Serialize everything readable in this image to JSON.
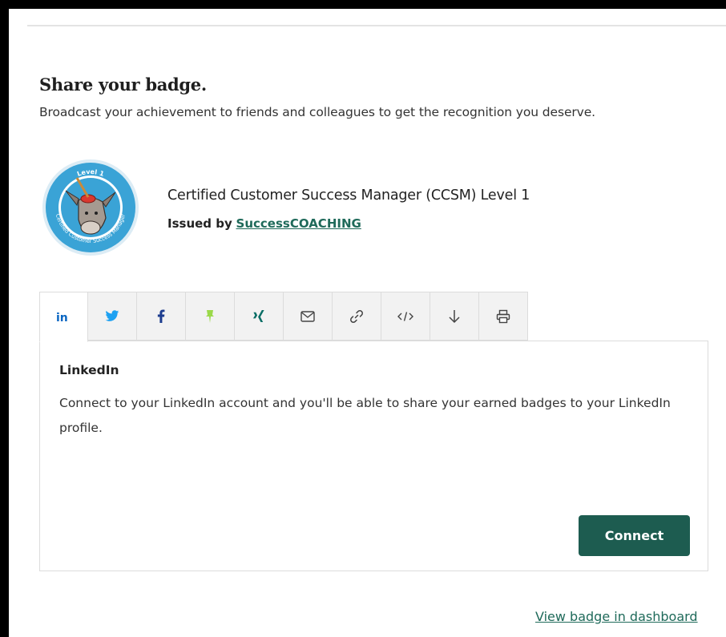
{
  "share": {
    "title": "Share your badge.",
    "subtitle": "Broadcast your achievement to friends and colleagues to get the recognition you deserve."
  },
  "badge": {
    "name": "Certified Customer Success Manager (CCSM) Level 1",
    "issued_by_label": "Issued by",
    "issuer": "SuccessCOACHING",
    "image_icon": "donkey-badge-icon",
    "ring_text_top": "Level 1",
    "ring_text_bottom": "Certified Customer Success Manager"
  },
  "tabs": [
    {
      "id": "linkedin",
      "icon": "linkedin-icon",
      "active": true
    },
    {
      "id": "twitter",
      "icon": "twitter-icon",
      "active": false
    },
    {
      "id": "facebook",
      "icon": "facebook-icon",
      "active": false
    },
    {
      "id": "ziprecruiter",
      "icon": "pin-icon",
      "active": false
    },
    {
      "id": "xing",
      "icon": "xing-icon",
      "active": false
    },
    {
      "id": "email",
      "icon": "email-icon",
      "active": false
    },
    {
      "id": "link",
      "icon": "link-icon",
      "active": false
    },
    {
      "id": "embed",
      "icon": "code-icon",
      "active": false
    },
    {
      "id": "download",
      "icon": "download-icon",
      "active": false
    },
    {
      "id": "print",
      "icon": "print-icon",
      "active": false
    }
  ],
  "panel": {
    "title": "LinkedIn",
    "text": "Connect to your LinkedIn account and you'll be able to share your earned badges to your LinkedIn profile.",
    "connect_label": "Connect"
  },
  "footer": {
    "dashboard_link": "View badge in dashboard"
  },
  "colors": {
    "accent": "#1d5c50",
    "link": "#1f6a5a",
    "linkedin": "#0a66c2",
    "twitter": "#1da1f2",
    "facebook": "#1877f2",
    "xing": "#0b6e66",
    "badge_blue": "#3aa3d6"
  }
}
